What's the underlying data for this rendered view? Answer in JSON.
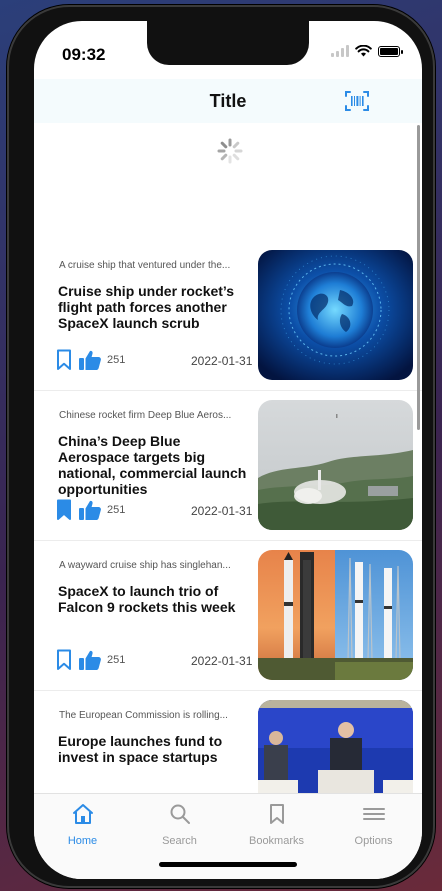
{
  "status": {
    "time": "09:32"
  },
  "navbar": {
    "title": "Title"
  },
  "colors": {
    "accent": "#2b8be6",
    "text": "#111111",
    "muted": "#9a9a9a"
  },
  "icons": {
    "scan": "barcode-scan-icon",
    "bookmark": "bookmark-icon",
    "like": "thumbs-up-icon",
    "spinner": "loading-spinner-icon"
  },
  "articles": [
    {
      "teaser": "A cruise ship that ventured under the...",
      "title": "Cruise ship under rocket’s flight path forces another SpaceX launch scrub",
      "likes": "251",
      "date": "2022-01-31",
      "bookmarked": false,
      "image": "blue digital globe"
    },
    {
      "teaser": "Chinese rocket firm Deep Blue Aeros...",
      "title": "China’s Deep Blue Aerospace targets big national, commercial launch opportunities",
      "likes": "251",
      "date": "2022-01-31",
      "bookmarked": true,
      "image": "rocket test launch in hills"
    },
    {
      "teaser": "A wayward cruise ship has singlehan...",
      "title": "SpaceX to launch trio of Falcon 9 rockets this week",
      "likes": "251",
      "date": "2022-01-31",
      "bookmarked": false,
      "image": "falcon 9 rockets on pads"
    },
    {
      "teaser": "The European Commission is rolling...",
      "title": "Europe launches fund to invest in space startups",
      "likes": "",
      "date": "",
      "bookmarked": false,
      "image": "EU press conference"
    }
  ],
  "tabs": [
    {
      "label": "Home",
      "icon": "home-icon",
      "active": true
    },
    {
      "label": "Search",
      "icon": "search-icon",
      "active": false
    },
    {
      "label": "Bookmarks",
      "icon": "bookmark-icon",
      "active": false
    },
    {
      "label": "Options",
      "icon": "menu-icon",
      "active": false
    }
  ]
}
